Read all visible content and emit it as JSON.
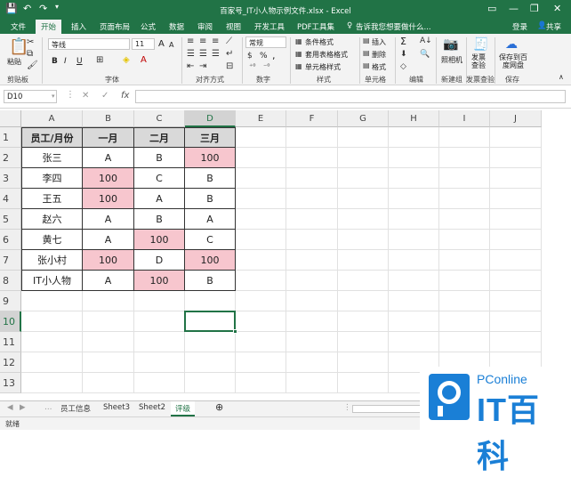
{
  "window": {
    "title": "百家号_IT小人物示例文件.xlsx - Excel",
    "min": "—",
    "max": "❐",
    "close": "✕"
  },
  "quick_access": {
    "save_icon": "💾",
    "undo_icon": "↶",
    "redo_icon": "↷"
  },
  "tabs": [
    "文件",
    "开始",
    "插入",
    "页面布局",
    "公式",
    "数据",
    "审阅",
    "视图",
    "开发工具",
    "PDF工具集"
  ],
  "active_tab": "开始",
  "tell_me": "告诉我您想要做什么...",
  "account": {
    "login": "登录",
    "share": "共享"
  },
  "ribbon": {
    "clipboard": {
      "paste": "粘贴",
      "label": "剪贴板"
    },
    "font": {
      "name": "等线",
      "size": "11",
      "bold": "B",
      "italic": "I",
      "underline": "U",
      "label": "字体",
      "grow": "A",
      "shrink": "A"
    },
    "alignment": {
      "label": "对齐方式"
    },
    "number": {
      "format": "常规",
      "label": "数字",
      "percent": "%",
      "comma": ","
    },
    "styles": {
      "conditional": "条件格式",
      "table": "套用表格格式",
      "cell": "单元格样式",
      "label": "样式"
    },
    "cells": {
      "insert": "插入",
      "delete": "删除",
      "format": "格式",
      "label": "单元格"
    },
    "editing": {
      "sum": "Σ",
      "label": "编辑"
    },
    "newgroup": {
      "photo": "照相机",
      "label": "新建组"
    },
    "invoice": {
      "check": "发票查验",
      "label": "发票查验"
    },
    "save": {
      "cloud": "保存到百度网盘",
      "label": "保存"
    }
  },
  "formula_bar": {
    "name_box": "D10",
    "cancel": "✕",
    "enter": "✓",
    "fx": "fx",
    "value": ""
  },
  "columns": [
    "A",
    "B",
    "C",
    "D",
    "E",
    "F",
    "G",
    "H",
    "I",
    "J"
  ],
  "selected_column": "D",
  "rows": [
    "1",
    "2",
    "3",
    "4",
    "5",
    "6",
    "7",
    "8",
    "9",
    "10",
    "11",
    "12",
    "13"
  ],
  "selected_row": "10",
  "table": {
    "header": [
      "员工/月份",
      "一月",
      "二月",
      "三月"
    ],
    "data": [
      [
        "张三",
        "A",
        "B",
        "100"
      ],
      [
        "李四",
        "100",
        "C",
        "B"
      ],
      [
        "王五",
        "100",
        "A",
        "B"
      ],
      [
        "赵六",
        "A",
        "B",
        "A"
      ],
      [
        "黄七",
        "A",
        "100",
        "C"
      ],
      [
        "张小村",
        "100",
        "D",
        "100"
      ],
      [
        "IT小人物",
        "A",
        "100",
        "B"
      ]
    ],
    "highlight_color": "#f7c6ce",
    "header_color": "#d9d9d9"
  },
  "sheets": [
    "员工信息",
    "Sheet3",
    "Sheet2",
    "评级"
  ],
  "active_sheet": "评级",
  "status": "就绪",
  "watermark": {
    "line1": "PConline",
    "line2": "IT百科"
  },
  "accent_color": "#217346"
}
